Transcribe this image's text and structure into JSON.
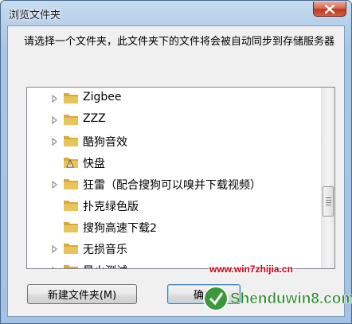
{
  "window": {
    "title": "浏览文件夹"
  },
  "instruction": "请选择一个文件夹，此文件夹下的文件将会被自动同步到存储服务器",
  "tree": {
    "items": [
      {
        "label": "Zigbee",
        "expandable": true,
        "selected": false,
        "special_icon": false
      },
      {
        "label": "ZZZ",
        "expandable": true,
        "selected": false,
        "special_icon": false
      },
      {
        "label": "酷狗音效",
        "expandable": true,
        "selected": false,
        "special_icon": false
      },
      {
        "label": "快盘",
        "expandable": false,
        "selected": true,
        "special_icon": true
      },
      {
        "label": "狂雷（配合搜狗可以嗅并下载视频）",
        "expandable": true,
        "selected": false,
        "special_icon": false
      },
      {
        "label": "扑克绿色版",
        "expandable": false,
        "selected": false,
        "special_icon": false
      },
      {
        "label": "搜狗高速下载2",
        "expandable": false,
        "selected": false,
        "special_icon": false
      },
      {
        "label": "无损音乐",
        "expandable": true,
        "selected": false,
        "special_icon": false
      },
      {
        "label": "星火测试",
        "expandable": true,
        "selected": false,
        "special_icon": false
      }
    ]
  },
  "buttons": {
    "new_folder": "新建文件夹(M)",
    "ok": "确定"
  },
  "watermark": {
    "site_text": "www.win7zhijia.cn",
    "logo_text": "Shenduwin8.com"
  },
  "colors": {
    "folder": "#e8c55a",
    "watermark_red": "#d0021b",
    "logo_green": "#2e8b2e"
  }
}
